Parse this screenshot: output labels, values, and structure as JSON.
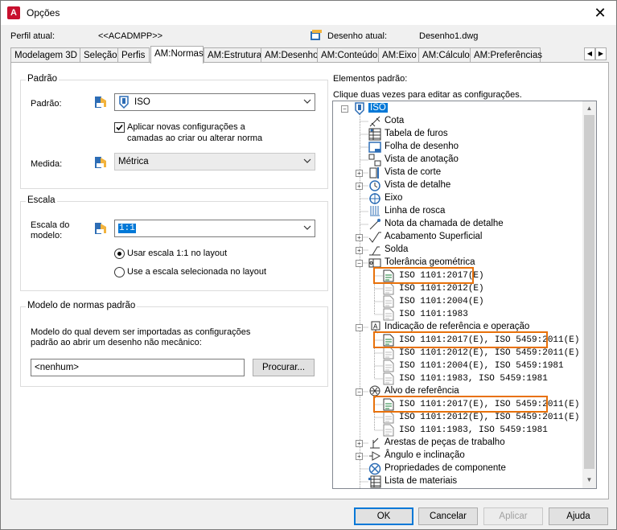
{
  "window": {
    "title": "Opções",
    "app_icon_letter": "A"
  },
  "header": {
    "profile_label": "Perfil atual:",
    "profile_value": "<<ACADMPP>>",
    "drawing_label": "Desenho atual:",
    "drawing_value": "Desenho1.dwg"
  },
  "tabs": [
    "Modelagem 3D",
    "Seleção",
    "Perfis",
    "AM:Normas",
    "AM:Estrutura",
    "AM:Desenho",
    "AM:Conteúdo",
    "AM:Eixo",
    "AM:Cálculo",
    "AM:Preferências"
  ],
  "active_tab": "AM:Normas",
  "padrao_group": {
    "title": "Padrão",
    "standard_label": "Padrão:",
    "standard_value": "ISO",
    "apply_checkbox_label_1": "Aplicar novas configurações a",
    "apply_checkbox_label_2": "camadas ao criar ou alterar norma",
    "apply_checked": true,
    "measure_label": "Medida:",
    "measure_value": "Métrica"
  },
  "escala_group": {
    "title": "Escala",
    "model_scale_label_1": "Escala do",
    "model_scale_label_2": "modelo:",
    "model_scale_value": "1:1",
    "radio_1": "Usar escala 1:1 no layout",
    "radio_2": "Use a escala selecionada no layout",
    "selected_radio": 1
  },
  "modelo_group": {
    "title": "Modelo de normas padrão",
    "description_1": "Modelo do qual devem ser importadas as configurações",
    "description_2": "padrão ao abrir um desenho não mecânico:",
    "template_value": "<nenhum>",
    "browse_button": "Procurar..."
  },
  "elements": {
    "title": "Elementos padrão:",
    "hint": "Clique duas vezes para editar as configurações.",
    "root": "ISO",
    "nodes": [
      {
        "label": "Cota"
      },
      {
        "label": "Tabela de furos"
      },
      {
        "label": "Folha de desenho"
      },
      {
        "label": "Vista de anotação"
      },
      {
        "label": "Vista de corte"
      },
      {
        "label": "Vista de detalhe"
      },
      {
        "label": "Eixo"
      },
      {
        "label": "Linha de rosca"
      },
      {
        "label": "Nota da chamada de detalhe"
      },
      {
        "label": "Acabamento Superficial"
      },
      {
        "label": "Solda"
      },
      {
        "label": "Tolerância geométrica"
      },
      {
        "label": "ISO 1101:2017(E)"
      },
      {
        "label": "ISO 1101:2012(E)"
      },
      {
        "label": "ISO 1101:2004(E)"
      },
      {
        "label": "ISO 1101:1983"
      },
      {
        "label": "Indicação de referência e operação"
      },
      {
        "label": "ISO 1101:2017(E), ISO 5459:2011(E)"
      },
      {
        "label": "ISO 1101:2012(E), ISO 5459:2011(E)"
      },
      {
        "label": "ISO 1101:2004(E), ISO 5459:1981"
      },
      {
        "label": "ISO 1101:1983, ISO 5459:1981"
      },
      {
        "label": "Alvo de referência"
      },
      {
        "label": "ISO 1101:2017(E), ISO 5459:2011(E)"
      },
      {
        "label": "ISO 1101:2012(E), ISO 5459:2011(E)"
      },
      {
        "label": "ISO 1101:1983, ISO 5459:1981"
      },
      {
        "label": "Arestas de peças de trabalho"
      },
      {
        "label": "Ângulo e inclinação"
      },
      {
        "label": "Propriedades de componente"
      },
      {
        "label": "Lista de materiais"
      }
    ]
  },
  "footer": {
    "ok": "OK",
    "cancel": "Cancelar",
    "apply": "Aplicar",
    "help": "Ajuda"
  },
  "colors": {
    "highlight": "#e8710a",
    "accent": "#0078d7",
    "app_red": "#c8102e"
  }
}
